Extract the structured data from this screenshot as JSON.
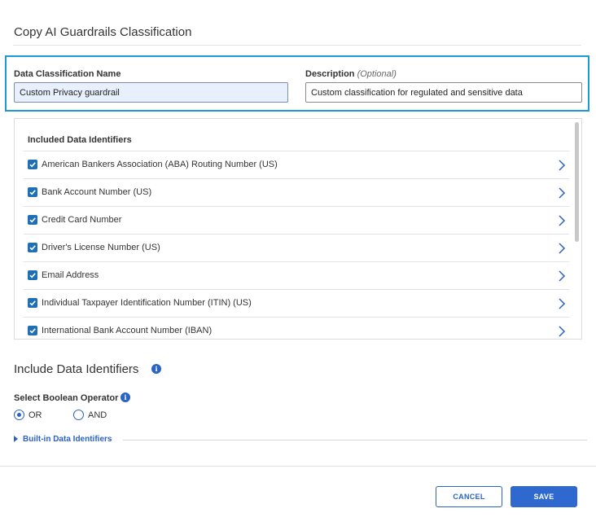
{
  "dialog": {
    "title": "Copy AI Guardrails Classification"
  },
  "form": {
    "name_label": "Data Classification Name",
    "name_value": "Custom Privacy guardrail",
    "description_label": "Description",
    "description_optional": "(Optional)",
    "description_value": "Custom classification for regulated and sensitive data"
  },
  "included": {
    "header": "Included Data Identifiers",
    "items": [
      {
        "label": "American Bankers Association (ABA) Routing Number (US)",
        "checked": true
      },
      {
        "label": "Bank Account Number (US)",
        "checked": true
      },
      {
        "label": "Credit Card Number",
        "checked": true
      },
      {
        "label": "Driver's License Number (US)",
        "checked": true
      },
      {
        "label": "Email Address",
        "checked": true
      },
      {
        "label": "Individual Taxpayer Identification Number (ITIN) (US)",
        "checked": true
      },
      {
        "label": "International Bank Account Number (IBAN)",
        "checked": true
      }
    ]
  },
  "include_section": {
    "title": "Include Data Identifiers",
    "operator_label": "Select Boolean Operator",
    "options": [
      {
        "label": "OR",
        "selected": true
      },
      {
        "label": "AND",
        "selected": false
      }
    ],
    "builtin_label": "Built-in Data Identifiers"
  },
  "footer": {
    "cancel_label": "CANCEL",
    "save_label": "SAVE"
  },
  "colors": {
    "accent": "#2b63c4",
    "highlight_border": "#1a9bd7",
    "checkbox": "#1f6fb5"
  }
}
